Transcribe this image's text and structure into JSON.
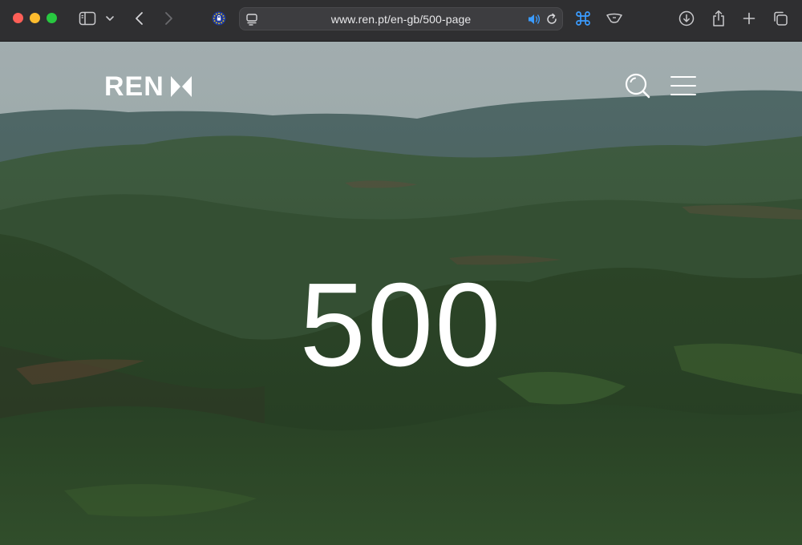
{
  "browser": {
    "url": "www.ren.pt/en-gb/500-page"
  },
  "site": {
    "logo_text": "REN"
  },
  "error": {
    "code": "500"
  },
  "icons": {
    "sidebar": "sidebar-icon",
    "chevron_down": "chevron-down-icon",
    "back": "chevron-left-icon",
    "forward": "chevron-right-icon",
    "privacy": "privacy-shield-icon",
    "reader": "reader-mode-icon",
    "audio": "speaker-icon",
    "reload": "reload-icon",
    "command": "command-icon",
    "extension": "extension-icon",
    "download": "download-icon",
    "share": "share-icon",
    "new_tab": "plus-icon",
    "tab_overview": "tabs-icon",
    "search": "search-icon",
    "menu": "hamburger-menu-icon"
  },
  "colors": {
    "chrome_bg": "#2f2f31",
    "accent": "#3b9cff",
    "text_on_page": "#ffffff"
  }
}
